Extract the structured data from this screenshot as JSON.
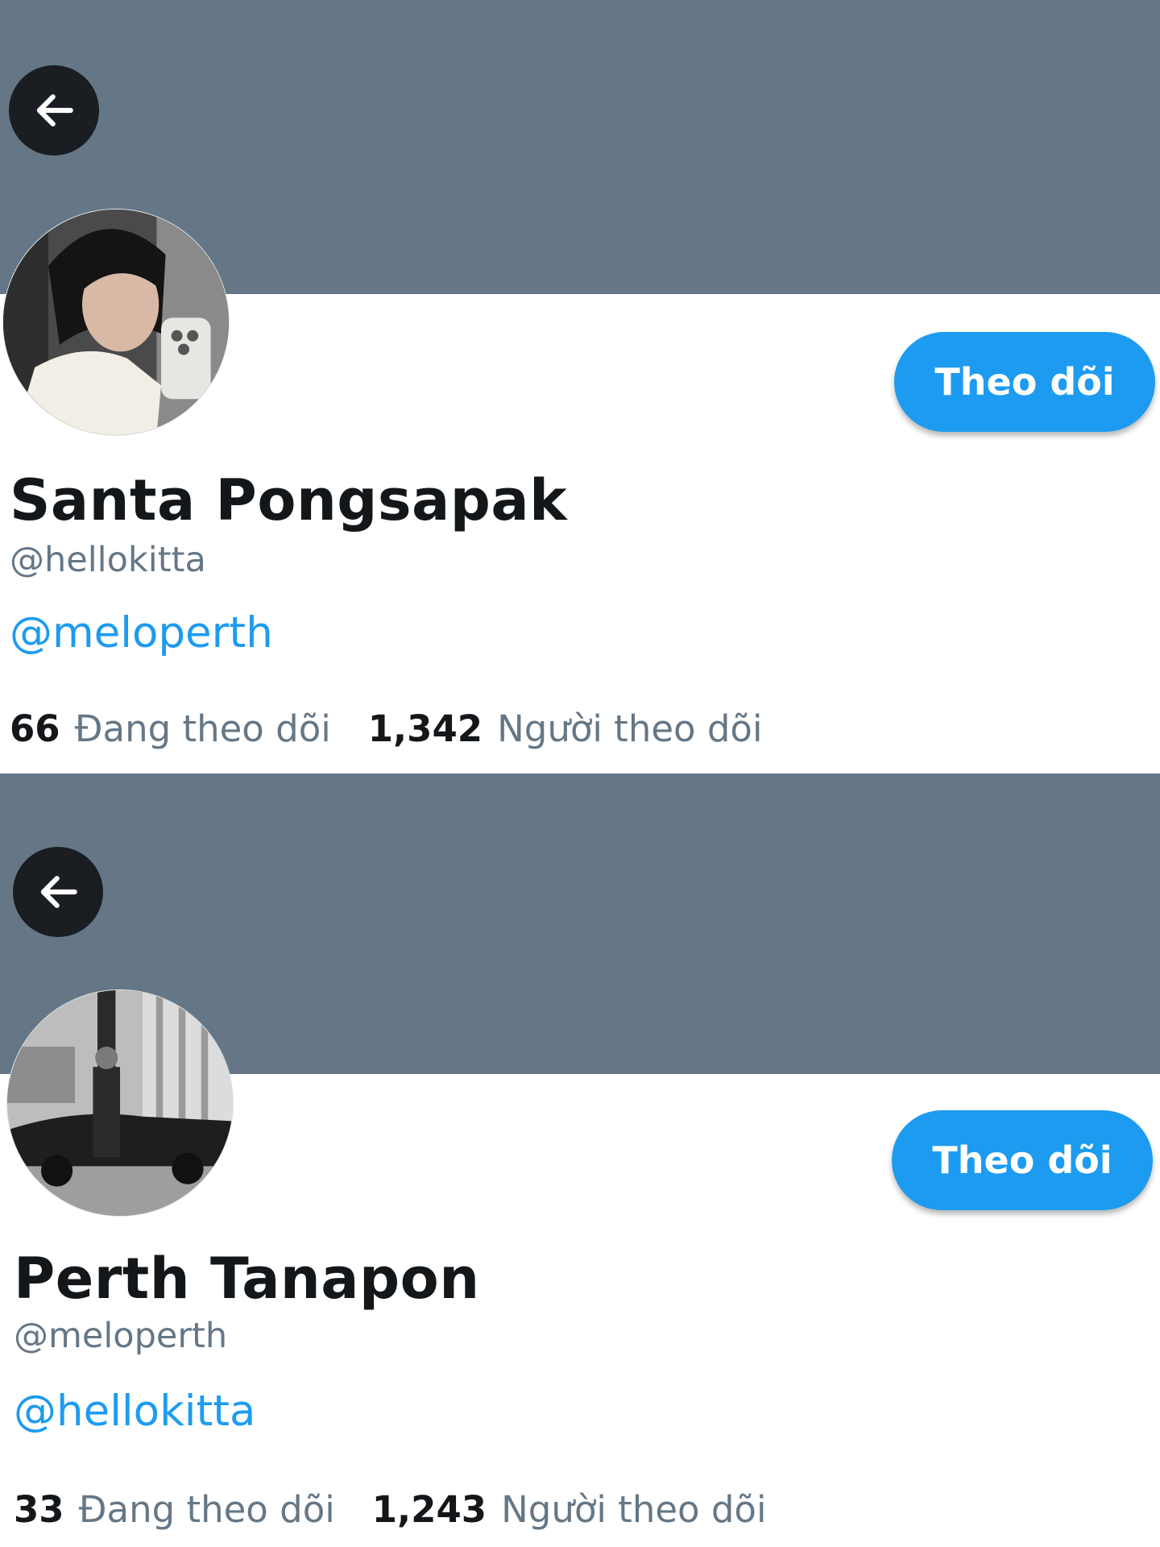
{
  "profiles": [
    {
      "display_name": "Santa Pongsapak",
      "handle": "@hellokitta",
      "bio_link": "@meloperth",
      "follow_label": "Theo dõi",
      "following_count": "66",
      "following_label": "Đang theo dõi",
      "followers_count": "1,342",
      "followers_label": "Người theo dõi",
      "back_icon": "arrow-left-icon",
      "banner_color": "#657786"
    },
    {
      "display_name": "Perth Tanapon",
      "handle": "@meloperth",
      "bio_link": "@hellokitta",
      "follow_label": "Theo dõi",
      "following_count": "33",
      "following_label": "Đang theo dõi",
      "followers_count": "1,243",
      "followers_label": "Người theo dõi",
      "back_icon": "arrow-left-icon",
      "banner_color": "#657786"
    }
  ],
  "colors": {
    "accent": "#1d9bf0",
    "text_primary": "#14171a",
    "text_secondary": "#657786"
  }
}
